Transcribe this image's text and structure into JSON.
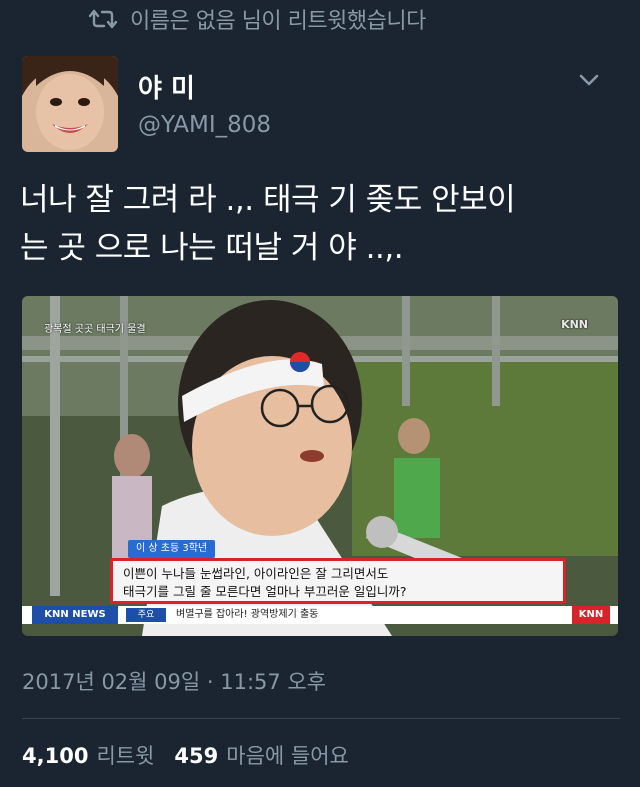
{
  "retweet": {
    "icon": "retweet-icon",
    "text": "이름은 없음 님이 리트윗했습니다"
  },
  "author": {
    "display_name": "야 미",
    "handle": "@YAMI_808",
    "avatar_icon": "avatar-photo"
  },
  "tweet": {
    "lines": [
      "너나 잘 그려 라 .,. 태극 기 좆도 안보이",
      "는 곳 으로 나는 떠날 거  야 ..,."
    ]
  },
  "media": {
    "top_label": "광복절 곳곳 태극기 물결",
    "corner_logo": "KNN",
    "name_tag": "이 상  초등  3학년",
    "quote_lines": [
      "이쁜이 누나들 눈썹라인, 아이라인은 잘 그리면서도",
      "태극기를 그릴 줄 모른다면 얼마나 부끄러운 일입니까?"
    ],
    "ticker_brand": "KNN NEWS",
    "ticker_tag": "주요",
    "ticker_text": "벼멸구를 잡아라! 광역방제기 출동",
    "ticker_logo": "KNN"
  },
  "timestamp": "2017년 02월 09일 · 11:57 오후",
  "stats": {
    "retweets_count": "4,100",
    "retweets_label": "리트윗",
    "likes_count": "459",
    "likes_label": "마음에 들어요"
  },
  "colors": {
    "background": "#1b2431",
    "secondary_text": "#8899a6",
    "primary_text": "#ffffff",
    "divider": "#38444d"
  }
}
